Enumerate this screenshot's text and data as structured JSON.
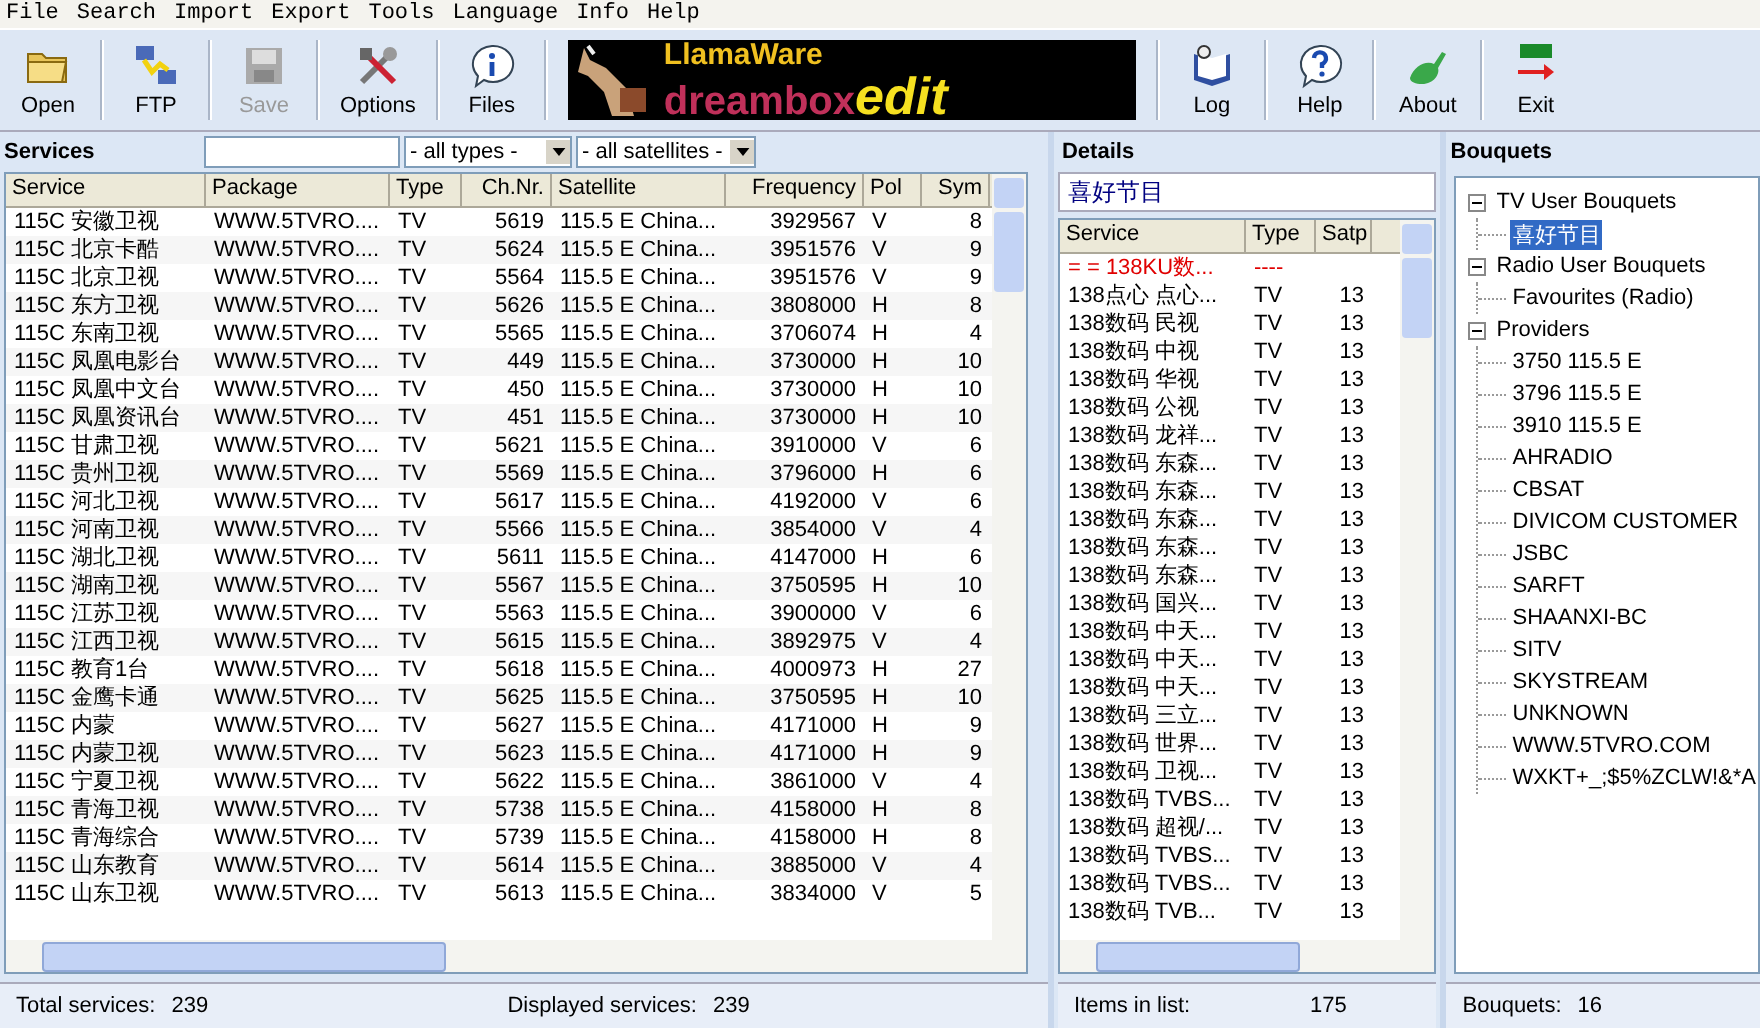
{
  "menu": [
    "File",
    "Search",
    "Import",
    "Export",
    "Tools",
    "Language",
    "Info",
    "Help"
  ],
  "toolbar": {
    "left": [
      {
        "label": "Open",
        "disabled": false
      },
      {
        "label": "FTP",
        "disabled": false
      },
      {
        "label": "Save",
        "disabled": true
      },
      {
        "label": "Options",
        "disabled": false
      },
      {
        "label": "Files",
        "disabled": false
      }
    ],
    "logo": {
      "brand": "LlamaWare",
      "product": "dreambox",
      "suffix": "edit"
    },
    "right": [
      {
        "label": "Log",
        "disabled": false
      },
      {
        "label": "Help",
        "disabled": false
      },
      {
        "label": "About",
        "disabled": false
      },
      {
        "label": "Exit",
        "disabled": false
      }
    ]
  },
  "services": {
    "title": "Services",
    "filters": {
      "type": "- all types -",
      "satellite": "- all satellites -"
    },
    "columns": [
      "Service",
      "Package",
      "Type",
      "Ch.Nr.",
      "Satellite",
      "Frequency",
      "Pol",
      "Sym"
    ],
    "rows": [
      [
        "115C  安徽卫视",
        "WWW.5TVRO....",
        "TV",
        "5619",
        "115.5 E China...",
        "3929567",
        "V",
        "8"
      ],
      [
        "115C  北京卡酷",
        "WWW.5TVRO....",
        "TV",
        "5624",
        "115.5 E China...",
        "3951576",
        "V",
        "9"
      ],
      [
        "115C  北京卫视",
        "WWW.5TVRO....",
        "TV",
        "5564",
        "115.5 E China...",
        "3951576",
        "V",
        "9"
      ],
      [
        "115C  东方卫视",
        "WWW.5TVRO....",
        "TV",
        "5626",
        "115.5 E China...",
        "3808000",
        "H",
        "8"
      ],
      [
        "115C  东南卫视",
        "WWW.5TVRO....",
        "TV",
        "5565",
        "115.5 E China...",
        "3706074",
        "H",
        "4"
      ],
      [
        "115C  凤凰电影台",
        "WWW.5TVRO....",
        "TV",
        "449",
        "115.5 E China...",
        "3730000",
        "H",
        "10"
      ],
      [
        "115C  凤凰中文台",
        "WWW.5TVRO....",
        "TV",
        "450",
        "115.5 E China...",
        "3730000",
        "H",
        "10"
      ],
      [
        "115C  凤凰资讯台",
        "WWW.5TVRO....",
        "TV",
        "451",
        "115.5 E China...",
        "3730000",
        "H",
        "10"
      ],
      [
        "115C  甘肃卫视",
        "WWW.5TVRO....",
        "TV",
        "5621",
        "115.5 E China...",
        "3910000",
        "V",
        "6"
      ],
      [
        "115C  贵州卫视",
        "WWW.5TVRO....",
        "TV",
        "5569",
        "115.5 E China...",
        "3796000",
        "H",
        "6"
      ],
      [
        "115C  河北卫视",
        "WWW.5TVRO....",
        "TV",
        "5617",
        "115.5 E China...",
        "4192000",
        "V",
        "6"
      ],
      [
        "115C  河南卫视",
        "WWW.5TVRO....",
        "TV",
        "5566",
        "115.5 E China...",
        "3854000",
        "V",
        "4"
      ],
      [
        "115C  湖北卫视",
        "WWW.5TVRO....",
        "TV",
        "5611",
        "115.5 E China...",
        "4147000",
        "H",
        "6"
      ],
      [
        "115C  湖南卫视",
        "WWW.5TVRO....",
        "TV",
        "5567",
        "115.5 E China...",
        "3750595",
        "H",
        "10"
      ],
      [
        "115C  江苏卫视",
        "WWW.5TVRO....",
        "TV",
        "5563",
        "115.5 E China...",
        "3900000",
        "V",
        "6"
      ],
      [
        "115C  江西卫视",
        "WWW.5TVRO....",
        "TV",
        "5615",
        "115.5 E China...",
        "3892975",
        "V",
        "4"
      ],
      [
        "115C  教育1台",
        "WWW.5TVRO....",
        "TV",
        "5618",
        "115.5 E China...",
        "4000973",
        "H",
        "27"
      ],
      [
        "115C  金鹰卡通",
        "WWW.5TVRO....",
        "TV",
        "5625",
        "115.5 E China...",
        "3750595",
        "H",
        "10"
      ],
      [
        "115C  内蒙",
        "WWW.5TVRO....",
        "TV",
        "5627",
        "115.5 E China...",
        "4171000",
        "H",
        "9"
      ],
      [
        "115C  内蒙卫视",
        "WWW.5TVRO....",
        "TV",
        "5623",
        "115.5 E China...",
        "4171000",
        "H",
        "9"
      ],
      [
        "115C  宁夏卫视",
        "WWW.5TVRO....",
        "TV",
        "5622",
        "115.5 E China...",
        "3861000",
        "V",
        "4"
      ],
      [
        "115C  青海卫视",
        "WWW.5TVRO....",
        "TV",
        "5738",
        "115.5 E China...",
        "4158000",
        "H",
        "8"
      ],
      [
        "115C  青海综合",
        "WWW.5TVRO....",
        "TV",
        "5739",
        "115.5 E China...",
        "4158000",
        "H",
        "8"
      ],
      [
        "115C  山东教育",
        "WWW.5TVRO....",
        "TV",
        "5614",
        "115.5 E China...",
        "3885000",
        "V",
        "4"
      ],
      [
        "115C  山东卫视",
        "WWW.5TVRO....",
        "TV",
        "5613",
        "115.5 E China...",
        "3834000",
        "V",
        "5"
      ]
    ],
    "status": {
      "total_label": "Total services:",
      "total": "239",
      "displayed_label": "Displayed services:",
      "displayed": "239"
    }
  },
  "details": {
    "title": "Details",
    "bouquet": "喜好节目",
    "columns": [
      "Service",
      "Type",
      "Satp"
    ],
    "rows": [
      {
        "kind": "marker",
        "cells": [
          "= = 138KU数...",
          "----",
          ""
        ]
      },
      {
        "kind": "channel",
        "cells": [
          "138点心  点心...",
          "TV",
          "13"
        ]
      },
      {
        "kind": "channel",
        "cells": [
          "138数码  民视",
          "TV",
          "13"
        ]
      },
      {
        "kind": "channel",
        "cells": [
          "138数码  中视",
          "TV",
          "13"
        ]
      },
      {
        "kind": "channel",
        "cells": [
          "138数码  华视",
          "TV",
          "13"
        ]
      },
      {
        "kind": "channel",
        "cells": [
          "138数码  公视",
          "TV",
          "13"
        ]
      },
      {
        "kind": "channel",
        "cells": [
          "138数码  龙祥...",
          "TV",
          "13"
        ]
      },
      {
        "kind": "channel",
        "cells": [
          "138数码  东森...",
          "TV",
          "13"
        ]
      },
      {
        "kind": "channel",
        "cells": [
          "138数码  东森...",
          "TV",
          "13"
        ]
      },
      {
        "kind": "channel",
        "cells": [
          "138数码  东森...",
          "TV",
          "13"
        ]
      },
      {
        "kind": "channel",
        "cells": [
          "138数码  东森...",
          "TV",
          "13"
        ]
      },
      {
        "kind": "channel",
        "cells": [
          "138数码  东森...",
          "TV",
          "13"
        ]
      },
      {
        "kind": "channel",
        "cells": [
          "138数码  国兴...",
          "TV",
          "13"
        ]
      },
      {
        "kind": "channel",
        "cells": [
          "138数码  中天...",
          "TV",
          "13"
        ]
      },
      {
        "kind": "channel",
        "cells": [
          "138数码  中天...",
          "TV",
          "13"
        ]
      },
      {
        "kind": "channel",
        "cells": [
          "138数码  中天...",
          "TV",
          "13"
        ]
      },
      {
        "kind": "channel",
        "cells": [
          "138数码  三立...",
          "TV",
          "13"
        ]
      },
      {
        "kind": "channel",
        "cells": [
          "138数码  世界...",
          "TV",
          "13"
        ]
      },
      {
        "kind": "channel",
        "cells": [
          "138数码  卫视...",
          "TV",
          "13"
        ]
      },
      {
        "kind": "channel",
        "cells": [
          "138数码  TVBS...",
          "TV",
          "13"
        ]
      },
      {
        "kind": "channel",
        "cells": [
          "138数码  超视/...",
          "TV",
          "13"
        ]
      },
      {
        "kind": "channel",
        "cells": [
          "138数码  TVBS...",
          "TV",
          "13"
        ]
      },
      {
        "kind": "channel",
        "cells": [
          "138数码  TVBS...",
          "TV",
          "13"
        ]
      },
      {
        "kind": "channel",
        "cells": [
          "138数码  TVB...",
          "TV",
          "13"
        ]
      }
    ],
    "status": {
      "label": "Items in list:",
      "value": "175"
    }
  },
  "bouquets": {
    "title": "Bouquets",
    "tree": [
      {
        "label": "TV User Bouquets",
        "expanded": true,
        "selected": false,
        "children": [
          {
            "label": "喜好节目",
            "selected": true
          }
        ]
      },
      {
        "label": "Radio User Bouquets",
        "expanded": true,
        "selected": false,
        "children": [
          {
            "label": "Favourites (Radio)",
            "selected": false
          }
        ]
      },
      {
        "label": "Providers",
        "expanded": true,
        "selected": false,
        "children": [
          {
            "label": "3750 115.5 E",
            "selected": false
          },
          {
            "label": "3796 115.5 E",
            "selected": false
          },
          {
            "label": "3910 115.5 E",
            "selected": false
          },
          {
            "label": "AHRADIO",
            "selected": false
          },
          {
            "label": "CBSAT",
            "selected": false
          },
          {
            "label": "DIVICOM CUSTOMER",
            "selected": false
          },
          {
            "label": "JSBC",
            "selected": false
          },
          {
            "label": "SARFT",
            "selected": false
          },
          {
            "label": "SHAANXI-BC",
            "selected": false
          },
          {
            "label": "SITV",
            "selected": false
          },
          {
            "label": "SKYSTREAM",
            "selected": false
          },
          {
            "label": "UNKNOWN",
            "selected": false
          },
          {
            "label": "WWW.5TVRO.COM",
            "selected": false
          },
          {
            "label": "WXKT+_;$5%ZCLW!&*A",
            "selected": false
          }
        ]
      }
    ],
    "status": {
      "label": "Bouquets:",
      "value": "16"
    }
  }
}
